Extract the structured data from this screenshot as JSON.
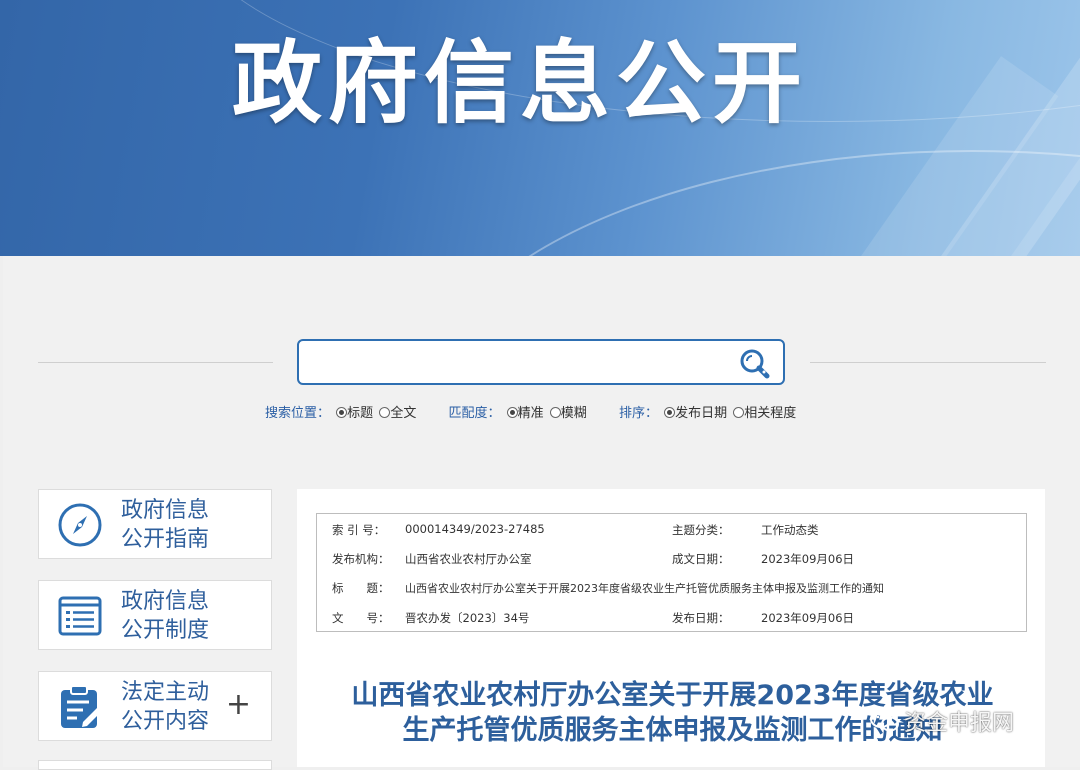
{
  "banner": {
    "title": "政府信息公开"
  },
  "search": {
    "placeholder": "",
    "position_label": "搜索位置：",
    "position_options": [
      "标题",
      "全文"
    ],
    "match_label": "匹配度：",
    "match_options": [
      "精准",
      "模糊"
    ],
    "sort_label": "排序：",
    "sort_options": [
      "发布日期",
      "相关程度"
    ]
  },
  "sidebar": {
    "items": [
      {
        "line1": "政府信息",
        "line2": "公开指南",
        "icon": "compass-icon"
      },
      {
        "line1": "政府信息",
        "line2": "公开制度",
        "icon": "list-icon"
      },
      {
        "line1": "法定主动",
        "line2": "公开内容",
        "icon": "clipboard-edit-icon",
        "expand": "+"
      }
    ]
  },
  "meta": {
    "index_label": "索 引 号：",
    "index_value": "000014349/2023-27485",
    "topic_label": "主题分类：",
    "topic_value": "工作动态类",
    "publisher_label": "发布机构：",
    "publisher_value": "山西省农业农村厅办公室",
    "created_label": "成文日期：",
    "created_value": "2023年09月06日",
    "title_label": "标　　题：",
    "title_value": "山西省农业农村厅办公室关于开展2023年度省级农业生产托管优质服务主体申报及监测工作的通知",
    "docno_label": "文　　号：",
    "docno_value": "晋农办发〔2023〕34号",
    "published_label": "发布日期：",
    "published_value": "2023年09月06日"
  },
  "document": {
    "title_line1": "山西省农业农村厅办公室关于开展2023年度省级农业",
    "title_line2": "生产托管优质服务主体申报及监测工作的通知"
  },
  "watermark": {
    "text": "资金申报网"
  },
  "colors": {
    "accent": "#2e6fb2",
    "title": "#2d5f9c"
  }
}
